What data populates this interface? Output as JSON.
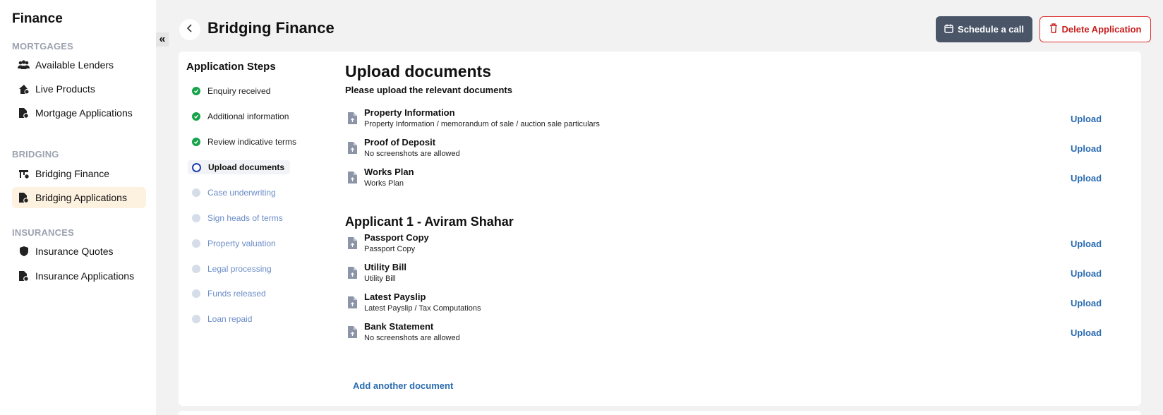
{
  "sidebar": {
    "brand": "Finance",
    "sections": [
      {
        "label": "MORTGAGES",
        "items": [
          {
            "label": "Available Lenders",
            "icon": "users-icon"
          },
          {
            "label": "Live Products",
            "icon": "home-icon"
          },
          {
            "label": "Mortgage Applications",
            "icon": "file-icon"
          }
        ]
      },
      {
        "label": "BRIDGING",
        "items": [
          {
            "label": "Bridging Finance",
            "icon": "bridge-icon"
          },
          {
            "label": "Bridging Applications",
            "icon": "file-icon",
            "active": true
          }
        ]
      },
      {
        "label": "INSURANCES",
        "items": [
          {
            "label": "Insurance Quotes",
            "icon": "shield-icon"
          },
          {
            "label": "Insurance Applications",
            "icon": "file-icon"
          }
        ]
      }
    ],
    "collapse_glyph": "«"
  },
  "header": {
    "title": "Bridging Finance",
    "schedule_label": "Schedule a call",
    "delete_label": "Delete Application"
  },
  "steps": {
    "title": "Application Steps",
    "items": [
      {
        "label": "Enquiry received",
        "status": "done"
      },
      {
        "label": "Additional information",
        "status": "done"
      },
      {
        "label": "Review indicative terms",
        "status": "done"
      },
      {
        "label": "Upload documents",
        "status": "current"
      },
      {
        "label": "Case underwriting",
        "status": "pending"
      },
      {
        "label": "Sign heads of terms",
        "status": "pending"
      },
      {
        "label": "Property valuation",
        "status": "pending"
      },
      {
        "label": "Legal processing",
        "status": "pending"
      },
      {
        "label": "Funds released",
        "status": "pending"
      },
      {
        "label": "Loan repaid",
        "status": "pending"
      }
    ]
  },
  "main": {
    "title": "Upload documents",
    "subtitle": "Please upload the relevant documents",
    "property_docs": [
      {
        "name": "Property Information",
        "desc": "Property Information / memorandum of sale / auction sale particulars",
        "action": "Upload"
      },
      {
        "name": "Proof of Deposit",
        "desc": "No screenshots are allowed",
        "action": "Upload"
      },
      {
        "name": "Works Plan",
        "desc": "Works Plan",
        "action": "Upload"
      }
    ],
    "applicant_heading": "Applicant 1 - Aviram Shahar",
    "applicant_docs": [
      {
        "name": "Passport Copy",
        "desc": "Passport Copy",
        "action": "Upload"
      },
      {
        "name": "Utility Bill",
        "desc": "Utility Bill",
        "action": "Upload"
      },
      {
        "name": "Latest Payslip",
        "desc": "Latest Payslip / Tax Computations",
        "action": "Upload"
      },
      {
        "name": "Bank Statement",
        "desc": "No screenshots are allowed",
        "action": "Upload"
      }
    ],
    "add_document_label": "Add another document"
  },
  "colors": {
    "accent_blue": "#2b6cb0",
    "done_green": "#16a34a",
    "delete_red": "#c81e1e",
    "schedule_bg": "#4a5568",
    "active_nav_bg": "#fdf1e0"
  }
}
